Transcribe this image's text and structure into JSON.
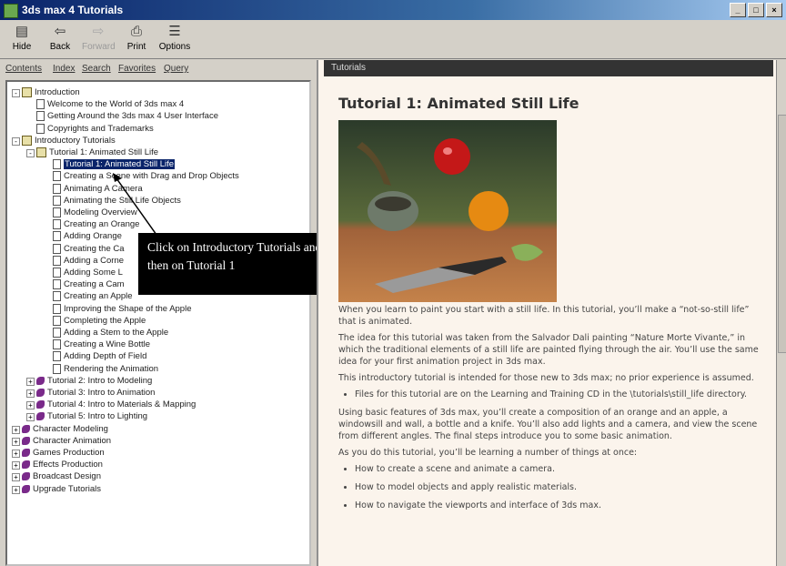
{
  "window": {
    "title": "3ds max 4 Tutorials"
  },
  "toolbar": {
    "buttons": [
      {
        "label": "Hide",
        "icon": "hide-icon"
      },
      {
        "label": "Back",
        "icon": "back-arrow-icon"
      },
      {
        "label": "Forward",
        "icon": "forward-arrow-icon"
      },
      {
        "label": "Print",
        "icon": "printer-icon"
      },
      {
        "label": "Options",
        "icon": "options-icon"
      }
    ]
  },
  "tabs": [
    "Contents",
    "Index",
    "Search",
    "Favorites",
    "Query"
  ],
  "tree": [
    {
      "label": "Introduction",
      "level": 0,
      "type": "book",
      "expander": "-"
    },
    {
      "label": "Welcome to the World of 3ds max 4",
      "level": 1,
      "type": "page"
    },
    {
      "label": "Getting Around the 3ds max 4 User Interface",
      "level": 1,
      "type": "page"
    },
    {
      "label": "Copyrights and Trademarks",
      "level": 1,
      "type": "page"
    },
    {
      "label": "Introductory Tutorials",
      "level": 0,
      "type": "book",
      "expander": "-"
    },
    {
      "label": "Tutorial 1: Animated Still Life",
      "level": 1,
      "type": "book",
      "expander": "-"
    },
    {
      "label": "Tutorial 1: Animated Still Life",
      "level": 2,
      "type": "page",
      "selected": true
    },
    {
      "label": "Creating a Scene with Drag and Drop Objects",
      "level": 2,
      "type": "page"
    },
    {
      "label": "Animating A Camera",
      "level": 2,
      "type": "page"
    },
    {
      "label": "Animating the Still Life Objects",
      "level": 2,
      "type": "page"
    },
    {
      "label": "Modeling Overview",
      "level": 2,
      "type": "page"
    },
    {
      "label": "Creating an Orange",
      "level": 2,
      "type": "page"
    },
    {
      "label": "Adding Orange",
      "level": 2,
      "type": "page"
    },
    {
      "label": "Creating the Ca",
      "level": 2,
      "type": "page"
    },
    {
      "label": "Adding a Corne",
      "level": 2,
      "type": "page"
    },
    {
      "label": "Adding Some L",
      "level": 2,
      "type": "page"
    },
    {
      "label": "Creating a Cam",
      "level": 2,
      "type": "page"
    },
    {
      "label": "Creating an Apple",
      "level": 2,
      "type": "page"
    },
    {
      "label": "Improving the Shape of the Apple",
      "level": 2,
      "type": "page"
    },
    {
      "label": "Completing the Apple",
      "level": 2,
      "type": "page"
    },
    {
      "label": "Adding a Stem to the Apple",
      "level": 2,
      "type": "page"
    },
    {
      "label": "Creating a Wine Bottle",
      "level": 2,
      "type": "page"
    },
    {
      "label": "Adding Depth of Field",
      "level": 2,
      "type": "page"
    },
    {
      "label": "Rendering the Animation",
      "level": 2,
      "type": "page"
    },
    {
      "label": "Tutorial 2: Intro to Modeling",
      "level": 1,
      "type": "purple",
      "expander": "+"
    },
    {
      "label": "Tutorial 3: Intro to Animation",
      "level": 1,
      "type": "purple",
      "expander": "+"
    },
    {
      "label": "Tutorial 4: Intro to Materials & Mapping",
      "level": 1,
      "type": "purple",
      "expander": "+"
    },
    {
      "label": "Tutorial 5: Intro to Lighting",
      "level": 1,
      "type": "purple",
      "expander": "+"
    },
    {
      "label": "Character Modeling",
      "level": 0,
      "type": "purple",
      "expander": "+"
    },
    {
      "label": "Character Animation",
      "level": 0,
      "type": "purple",
      "expander": "+"
    },
    {
      "label": "Games Production",
      "level": 0,
      "type": "purple",
      "expander": "+"
    },
    {
      "label": "Effects Production",
      "level": 0,
      "type": "purple",
      "expander": "+"
    },
    {
      "label": "Broadcast Design",
      "level": 0,
      "type": "purple",
      "expander": "+"
    },
    {
      "label": "Upgrade Tutorials",
      "level": 0,
      "type": "purple",
      "expander": "+"
    }
  ],
  "callout": {
    "text": "Click on Introductory Tutorials and then on Tutorial 1"
  },
  "article": {
    "breadcrumb": "Tutorials",
    "title": "Tutorial 1: Animated Still Life",
    "paragraphs": [
      "When you learn to paint you start with a still life. In this tutorial, you’ll make a “not-so-still life” that is animated.",
      "The idea for this tutorial was taken from the Salvador Dali painting “Nature Morte Vivante,” in which the traditional elements of a still life are painted flying through the air. You’ll use the same idea for your first animation project in 3ds max.",
      "This introductory tutorial is intended for those new to 3ds max; no prior experience is assumed."
    ],
    "note": "Files for this tutorial are on the Learning and Training CD in the \\tutorials\\still_life directory.",
    "paragraphs2": [
      "Using basic features of 3ds max, you’ll create a composition of an orange and an apple, a windowsill and wall, a bottle and a knife. You’ll also add lights and a camera, and view the scene from different angles. The final steps introduce you to some basic animation.",
      "As you do this tutorial, you’ll be learning a number of things at once:"
    ],
    "bullets": [
      "How to create a scene and animate a camera.",
      "How to model objects and apply realistic materials.",
      "How to navigate the viewports and interface of 3ds max."
    ]
  }
}
